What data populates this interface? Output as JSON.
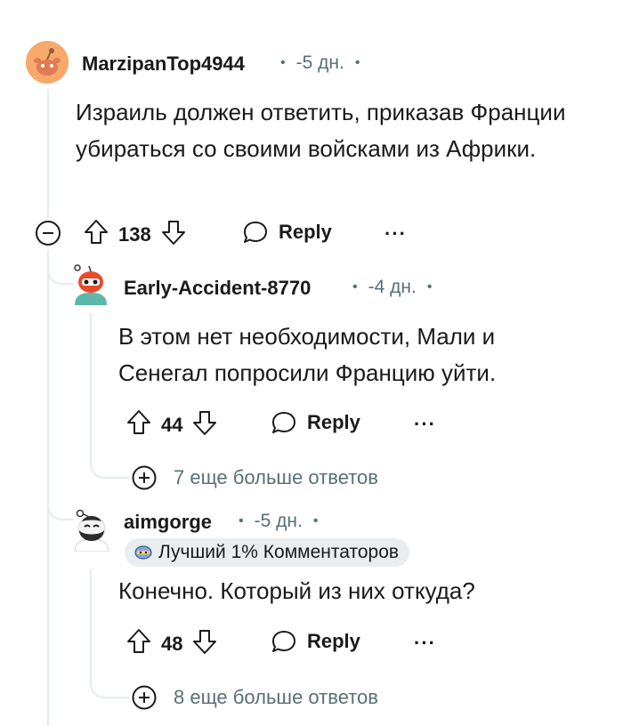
{
  "comments": [
    {
      "username": "MarzipanTop4944",
      "time": "-5 дн.",
      "body": "Израиль должен ответить, приказав Франции убираться со своими войсками из Африки.",
      "votes": "138",
      "reply_label": "Reply",
      "more_label": "···"
    },
    {
      "username": "Early-Accident-8770",
      "time": "-4 дн.",
      "body": "В этом нет необходимости, Мали и Сенегал попросили Францию уйти.",
      "votes": "44",
      "reply_label": "Reply",
      "more_label": "···",
      "more_replies": "7 еще больше ответов"
    },
    {
      "username": "aimgorge",
      "time": "-5 дн.",
      "flair": "Лучший 1% Комментаторов",
      "body": "Конечно. Который из них откуда?",
      "votes": "48",
      "reply_label": "Reply",
      "more_label": "···",
      "more_replies": "8 еще больше ответов"
    }
  ],
  "colors": {
    "text": "#1a1a1b",
    "meta": "#576f76",
    "threadline": "#e5ebee",
    "avatar1_bg": "#f4a460",
    "flair_bg": "#eaedef"
  },
  "icons": [
    "collapse-icon",
    "upvote-icon",
    "downvote-icon",
    "reply-icon",
    "more-icon",
    "expand-icon",
    "flair-icon"
  ]
}
